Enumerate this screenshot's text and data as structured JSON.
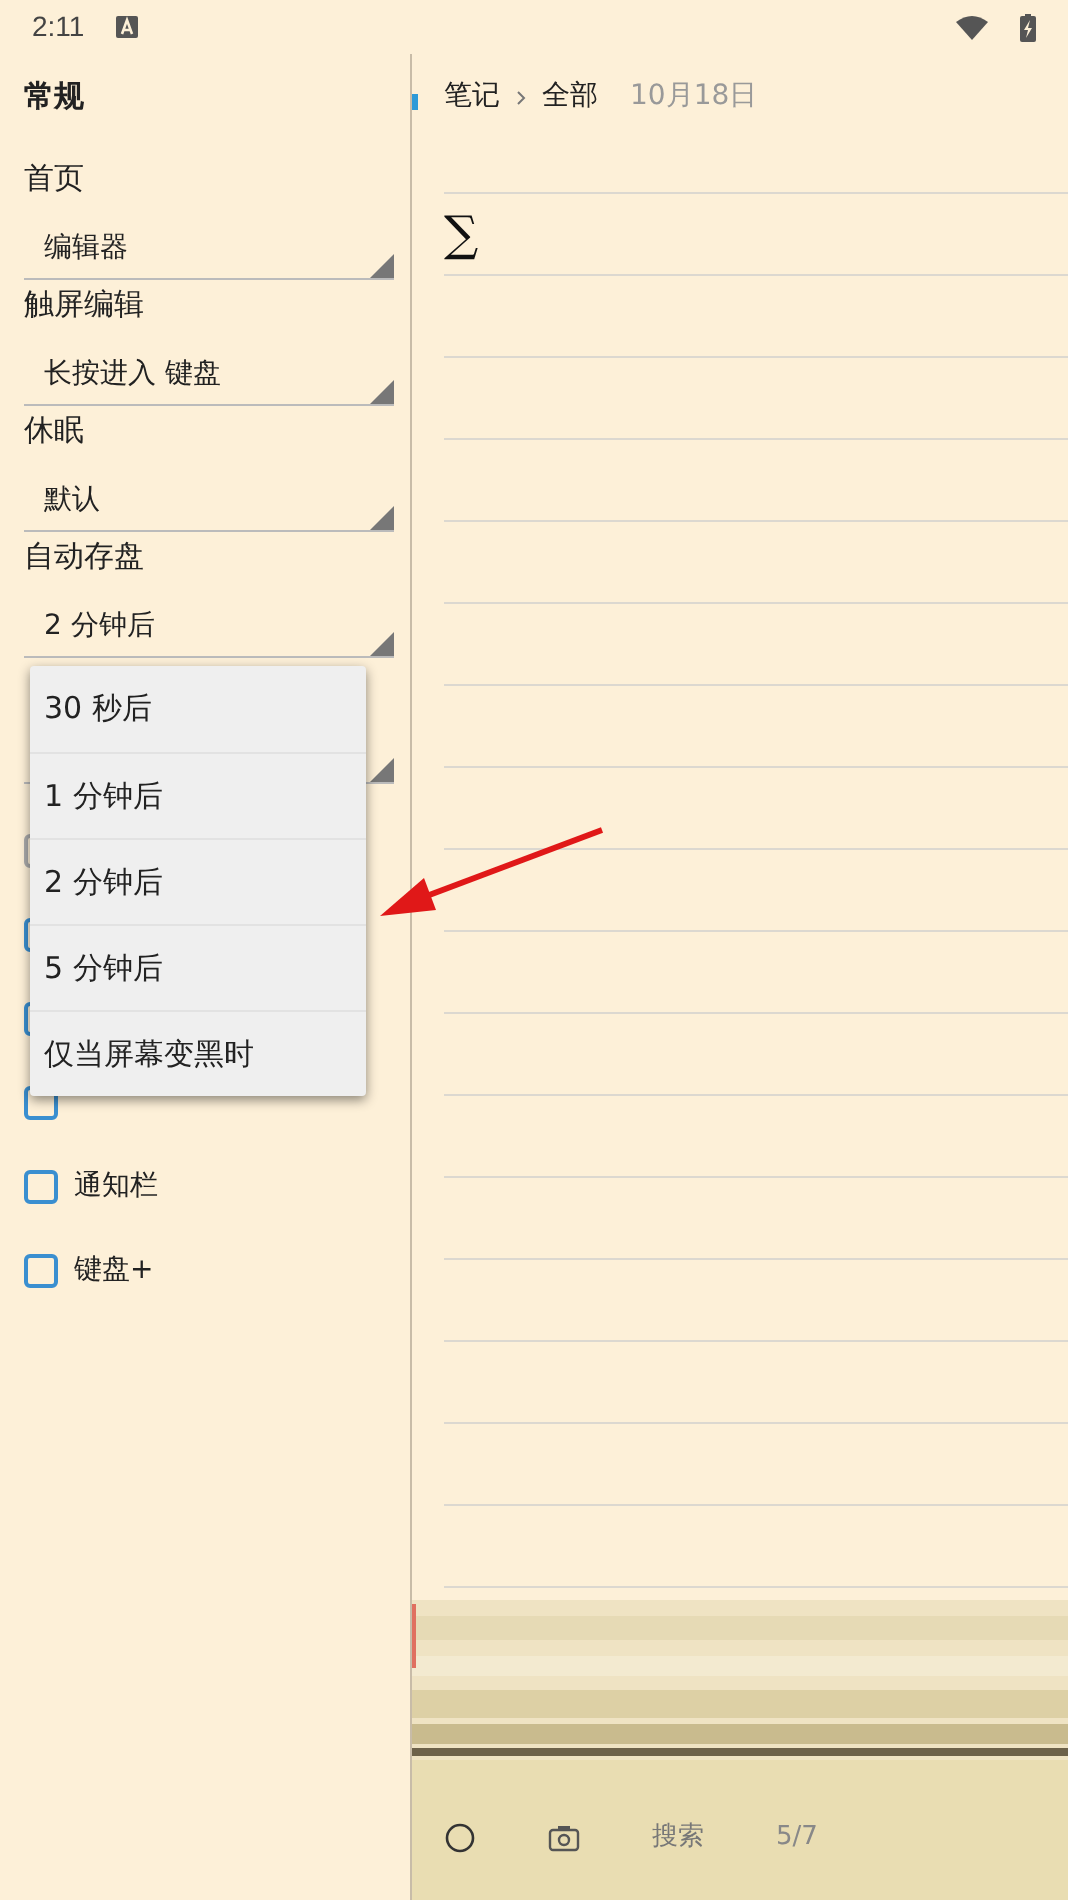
{
  "status_bar": {
    "time": "2:11"
  },
  "sidebar": {
    "title": "常规",
    "settings": [
      {
        "kind": "select",
        "label": "首页",
        "value": "编辑器"
      },
      {
        "kind": "select",
        "label": "触屏编辑",
        "value": "长按进入 键盘"
      },
      {
        "kind": "select",
        "label": "休眠",
        "value": "默认"
      },
      {
        "kind": "select",
        "label": "自动存盘",
        "value": "2 分钟后"
      },
      {
        "kind": "select"
      }
    ],
    "checkboxes": [
      {
        "checked": false,
        "disabled": true
      },
      {
        "checked": false,
        "disabled": false
      },
      {
        "checked": false,
        "disabled": false
      },
      {
        "checked": false,
        "disabled": false
      },
      {
        "label": "通知栏",
        "checked": false,
        "disabled": false
      },
      {
        "label": "键盘+",
        "checked": false,
        "disabled": false
      }
    ]
  },
  "dropdown_menu": {
    "options": [
      "30 秒后",
      "1 分钟后",
      "2 分钟后",
      "5 分钟后",
      "仅当屏幕变黑时"
    ]
  },
  "note": {
    "breadcrumb": [
      "笔记",
      "全部"
    ],
    "date": "10月18日",
    "lines": [
      "∑"
    ]
  },
  "toolbar": {
    "search": "搜索",
    "page": "5/7"
  }
}
